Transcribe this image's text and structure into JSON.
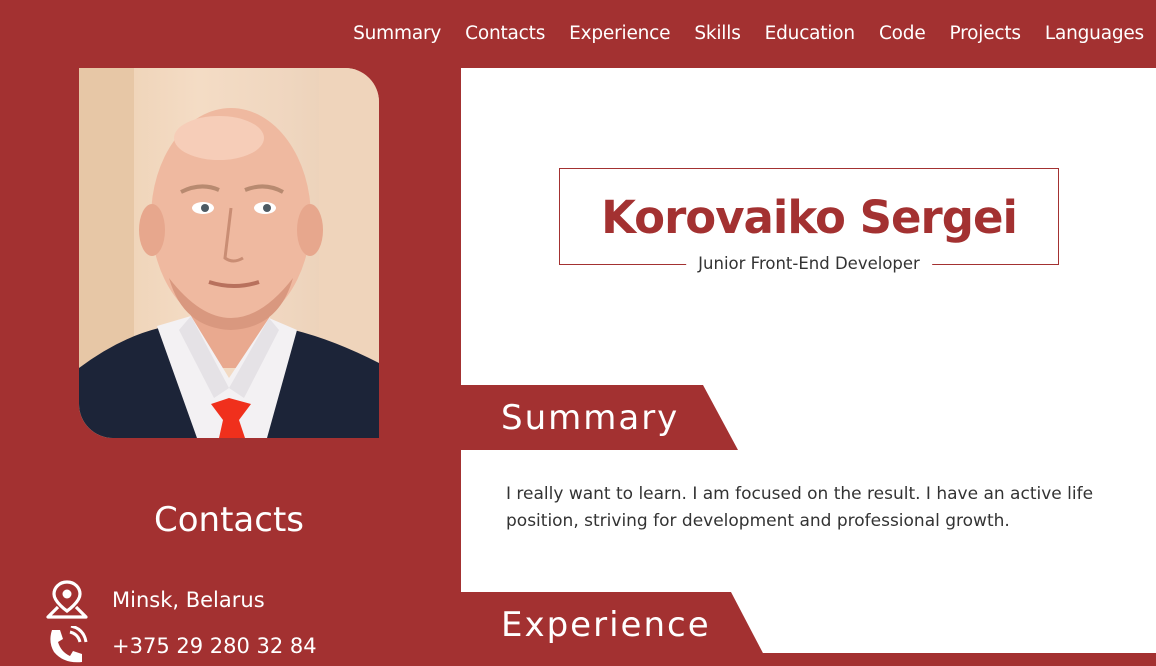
{
  "nav": {
    "items": [
      "Summary",
      "Contacts",
      "Experience",
      "Skills",
      "Education",
      "Code",
      "Projects",
      "Languages"
    ]
  },
  "profile": {
    "name": "Korovaiko Sergei",
    "role": "Junior Front-End Developer"
  },
  "contacts": {
    "title": "Contacts",
    "location": "Minsk, Belarus",
    "phone": "+375 29 280 32 84"
  },
  "sections": {
    "summary_title": "Summary",
    "summary_text": "I really want to learn. I am focused on the result. I have an active life position, striving for development and professional growth.",
    "experience_title": "Experience"
  },
  "colors": {
    "brand": "#a33131",
    "panel": "#ffffff",
    "text": "#333333"
  },
  "icons": {
    "location": "location-pin-icon",
    "phone": "phone-icon"
  }
}
